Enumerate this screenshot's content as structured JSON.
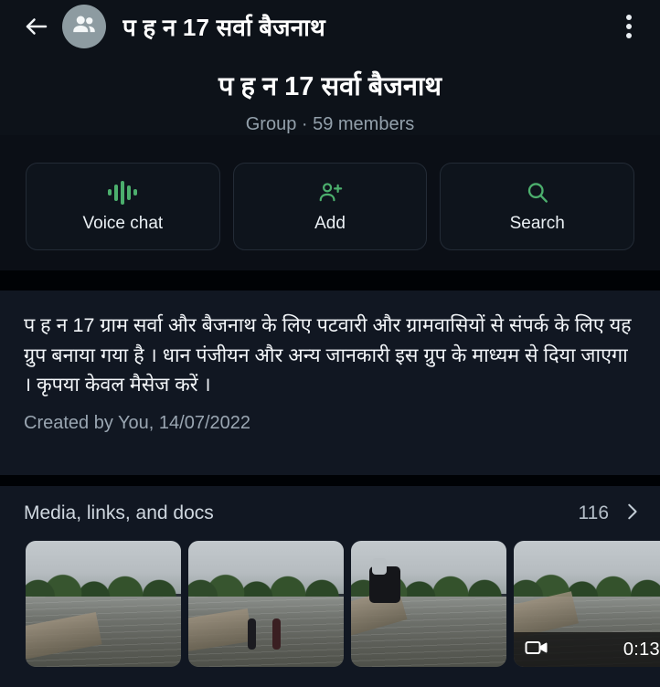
{
  "appbar": {
    "back_icon": "arrow-left-icon",
    "avatar_icon": "group-people-icon",
    "title": "प ह न 17 सर्वा बैजनाथ",
    "overflow_icon": "more-vert-icon"
  },
  "header": {
    "group_name": "प ह न 17 सर्वा बैजनाथ",
    "meta": "Group · 59 members"
  },
  "actions": [
    {
      "label": "Voice chat",
      "icon": "voice-waveform-icon"
    },
    {
      "label": "Add",
      "icon": "person-add-icon"
    },
    {
      "label": "Search",
      "icon": "search-icon"
    }
  ],
  "description": {
    "text": "प ह न 17 ग्राम सर्वा और बैजनाथ के लिए पटवारी और ग्रामवासियों से संपर्क के लिए यह ग्रुप बनाया गया है । धान पंजीयन और अन्य जानकारी इस ग्रुप के माध्यम से दिया जाएगा । कृपया केवल मैसेज करें ।",
    "created_by": "Created by You, 14/07/2022"
  },
  "media": {
    "title": "Media, links, and docs",
    "count": "116",
    "chevron_icon": "chevron-right-icon",
    "thumbnails": [
      {
        "kind": "photo",
        "caption": "flooded-road-bridge-1"
      },
      {
        "kind": "photo",
        "caption": "flooded-road-people-2"
      },
      {
        "kind": "photo",
        "caption": "flooded-road-motorcycle-3"
      },
      {
        "kind": "video",
        "caption": "flooded-road-video-4",
        "duration": "0:13",
        "video_icon": "video-camera-icon"
      }
    ]
  },
  "colors": {
    "accent_green": "#4caf6d",
    "panel": "#111722",
    "appbar": "#0d1219",
    "page": "#0b0f16"
  }
}
